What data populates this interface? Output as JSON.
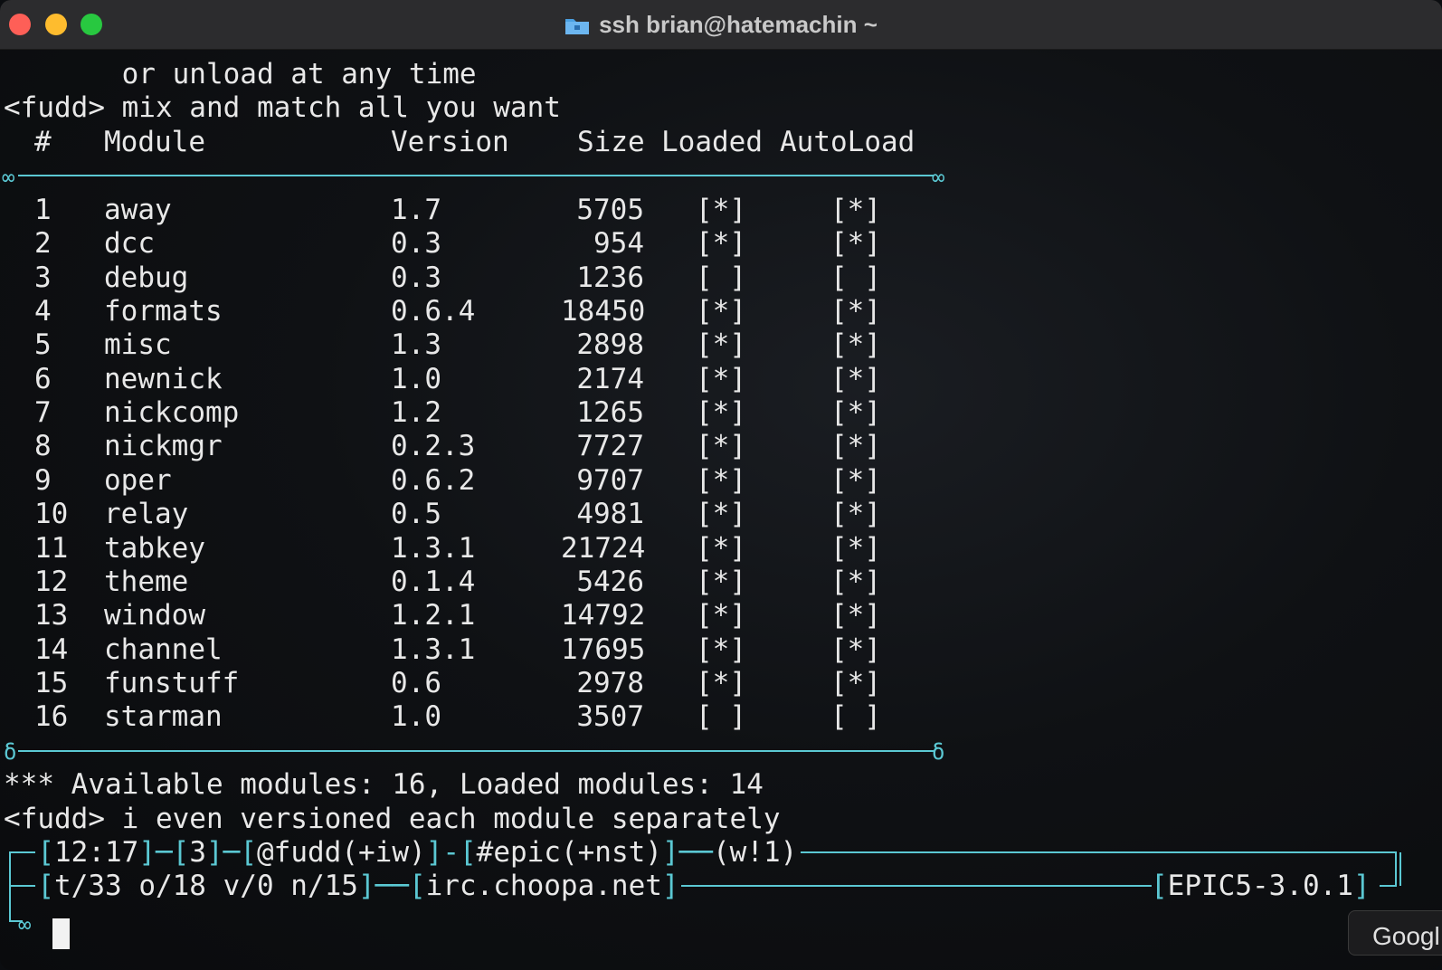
{
  "window": {
    "title": "ssh brian@hatemachin ~"
  },
  "intro": {
    "line1": "       or unload at any time",
    "line2": "<fudd> mix and match all you want"
  },
  "table": {
    "headers": {
      "num": "#",
      "module": "Module",
      "version": "Version",
      "size": "Size",
      "loaded": "Loaded",
      "autoload": "AutoLoad"
    },
    "top_rule_icon": "∞",
    "bottom_rule_icon": "δ",
    "rows": [
      {
        "num": "1",
        "module": "away",
        "version": "1.7",
        "size": "5705",
        "loaded": "[*]",
        "autoload": "[*]"
      },
      {
        "num": "2",
        "module": "dcc",
        "version": "0.3",
        "size": "954",
        "loaded": "[*]",
        "autoload": "[*]"
      },
      {
        "num": "3",
        "module": "debug",
        "version": "0.3",
        "size": "1236",
        "loaded": "[ ]",
        "autoload": "[ ]"
      },
      {
        "num": "4",
        "module": "formats",
        "version": "0.6.4",
        "size": "18450",
        "loaded": "[*]",
        "autoload": "[*]"
      },
      {
        "num": "5",
        "module": "misc",
        "version": "1.3",
        "size": "2898",
        "loaded": "[*]",
        "autoload": "[*]"
      },
      {
        "num": "6",
        "module": "newnick",
        "version": "1.0",
        "size": "2174",
        "loaded": "[*]",
        "autoload": "[*]"
      },
      {
        "num": "7",
        "module": "nickcomp",
        "version": "1.2",
        "size": "1265",
        "loaded": "[*]",
        "autoload": "[*]"
      },
      {
        "num": "8",
        "module": "nickmgr",
        "version": "0.2.3",
        "size": "7727",
        "loaded": "[*]",
        "autoload": "[*]"
      },
      {
        "num": "9",
        "module": "oper",
        "version": "0.6.2",
        "size": "9707",
        "loaded": "[*]",
        "autoload": "[*]"
      },
      {
        "num": "10",
        "module": "relay",
        "version": "0.5",
        "size": "4981",
        "loaded": "[*]",
        "autoload": "[*]"
      },
      {
        "num": "11",
        "module": "tabkey",
        "version": "1.3.1",
        "size": "21724",
        "loaded": "[*]",
        "autoload": "[*]"
      },
      {
        "num": "12",
        "module": "theme",
        "version": "0.1.4",
        "size": "5426",
        "loaded": "[*]",
        "autoload": "[*]"
      },
      {
        "num": "13",
        "module": "window",
        "version": "1.2.1",
        "size": "14792",
        "loaded": "[*]",
        "autoload": "[*]"
      },
      {
        "num": "14",
        "module": "channel",
        "version": "1.3.1",
        "size": "17695",
        "loaded": "[*]",
        "autoload": "[*]"
      },
      {
        "num": "15",
        "module": "funstuff",
        "version": "0.6",
        "size": "2978",
        "loaded": "[*]",
        "autoload": "[*]"
      },
      {
        "num": "16",
        "module": "starman",
        "version": "1.0",
        "size": "3507",
        "loaded": "[ ]",
        "autoload": "[ ]"
      }
    ]
  },
  "summary": "*** Available modules: 16, Loaded modules: 14",
  "chat_line": "<fudd> i even versioned each module separately",
  "statusbar": {
    "time": "12:17",
    "window_num": "3",
    "nick": "@fudd",
    "nick_mode": "(+iw)",
    "channel": "#epic",
    "channel_mode": "(+nst)",
    "refnum": "(w!1)",
    "counts": "t/33 o/18 v/0 n/15",
    "server": "irc.choopa.net",
    "client": "EPIC5-3.0.1"
  },
  "prompt_icon": "∞",
  "overlay_button": "Googl",
  "colors": {
    "accent": "#5bc8d3",
    "text": "#e8e8e8",
    "background": "#0b0d10"
  }
}
